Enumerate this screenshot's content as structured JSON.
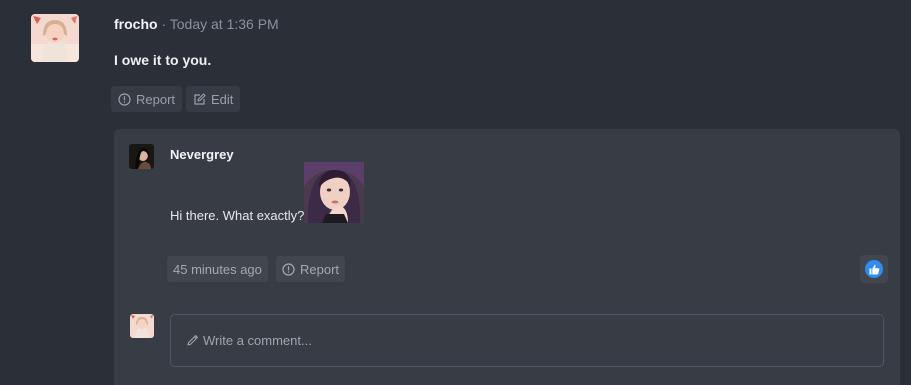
{
  "post": {
    "author": "frocho",
    "separator": " · ",
    "timestamp": "Today at 1:36 PM",
    "text": "I owe it to you.",
    "actions": {
      "report_label": "Report",
      "edit_label": "Edit"
    }
  },
  "comment": {
    "author": "Nevergrey",
    "text": "Hi there. What exactly?",
    "time_ago": "45 minutes ago",
    "report_label": "Report",
    "like_color": "#2d8ef0"
  },
  "composer": {
    "placeholder": "Write a comment..."
  },
  "colors": {
    "background": "#2b2f37",
    "comment_panel": "#383c45",
    "button_bg": "#363b44",
    "accent_like": "#2d8ef0"
  },
  "icons": {
    "report": "info-circle-icon",
    "edit": "edit-icon",
    "like": "thumbs-up-icon",
    "pencil": "pencil-icon"
  }
}
